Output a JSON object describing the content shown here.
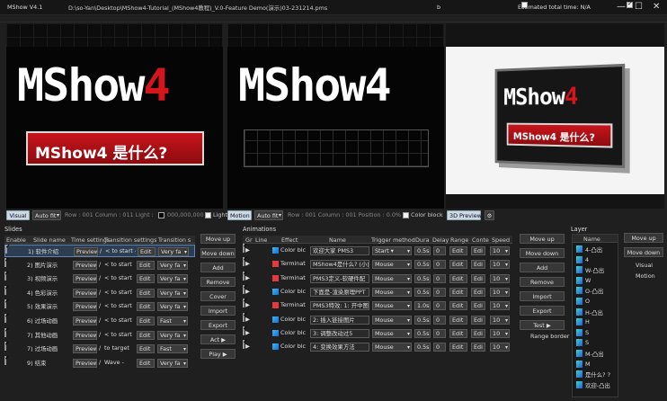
{
  "window": {
    "title": "MShow V4.1",
    "path": "D:\\so-Yan\\Desktop\\MShow4-Tutorial_(MShow4教程)_V.0-Feature Demo(演示)03-231214.pms",
    "letter_b": "b",
    "estimated": "Estimated total time: N/A",
    "min": "—",
    "max": "☐",
    "close": "✕"
  },
  "viewer": {
    "title_a": "MShow",
    "title_b": "4",
    "banner": "MShow4 是什么?"
  },
  "viewer_bar": {
    "visual": "Visual",
    "autofit": "Auto fit",
    "row1": "Row : 001  Column : 011  Light : ",
    "color_val": "000,000,000",
    "light": "Light",
    "motion": "Motion",
    "autofit2": "Auto fit",
    "row2": "Row : 001  Column : 001  Position : 0.0%",
    "colorblock": "Color block",
    "preview3d": "3D Preview",
    "gear": "⚙"
  },
  "slides": {
    "label": "Slides",
    "headers": [
      "Enable",
      "Slide name",
      "Time settings",
      "Transition settings",
      "Transition s"
    ],
    "rows": [
      {
        "name": "1) 软件介绍",
        "preview": "Preview",
        "mid": "/",
        "start": "< to start -",
        "edit": "Edit",
        "speed": "Very fa"
      },
      {
        "name": "2) 图片演示",
        "preview": "Preview",
        "mid": "/",
        "start": "< to start",
        "edit": "Edit",
        "speed": "Very fa"
      },
      {
        "name": "3) 视频演示",
        "preview": "Preview",
        "mid": "/",
        "start": "< to start",
        "edit": "Edit",
        "speed": "Very fa"
      },
      {
        "name": "4) 色彩演示",
        "preview": "Preview",
        "mid": "/",
        "start": "< to start",
        "edit": "Edit",
        "speed": "Very fa"
      },
      {
        "name": "5) 效果演示",
        "preview": "Preview",
        "mid": "/",
        "start": "< to start",
        "edit": "Edit",
        "speed": "Very fa"
      },
      {
        "name": "6) 过场动画",
        "preview": "Preview",
        "mid": "/",
        "start": "< to start",
        "edit": "Edit",
        "speed": "Fast"
      },
      {
        "name": "7) 其他动画",
        "preview": "Preview",
        "mid": "/",
        "start": "< to start",
        "edit": "Edit",
        "speed": "Very fa"
      },
      {
        "name": "7) 过场动画",
        "preview": "Preview",
        "mid": "/",
        "start": "to target",
        "edit": "Edit",
        "speed": "Fast"
      },
      {
        "name": "9) 结束",
        "preview": "Preview",
        "mid": "/",
        "start": "Wave -",
        "edit": "Edit",
        "speed": "Very fa"
      }
    ],
    "buttons": [
      "Move up",
      "Move down",
      "Add",
      "Remove",
      "Cover",
      "Import",
      "Export",
      "Act ▶",
      "Play ▶"
    ]
  },
  "animations": {
    "label": "Animations",
    "headers": [
      "Gr",
      "Line",
      "Effect",
      "Name",
      "Trigger method",
      "Dura",
      "Delay",
      "Range",
      "Conte",
      "Speed"
    ],
    "rows": [
      {
        "effect": "Color blc",
        "icon": "cb",
        "name": "欢迎大家 PMS3",
        "trigger": "Start ▾",
        "dura": "0.5s",
        "delay": "0",
        "range": "Edit",
        "conte": "Edi",
        "speed": "10"
      },
      {
        "effect": "Terminat",
        "icon": "term",
        "name": "MShow4是什么? (小)",
        "trigger": "Mouse",
        "dura": "0.5s",
        "delay": "0",
        "range": "Edit",
        "conte": "Edi",
        "speed": "10"
      },
      {
        "effect": "Terminat",
        "icon": "term",
        "name": "PMS3定义-软硬件配",
        "trigger": "Mouse",
        "dura": "0.5s",
        "delay": "0",
        "range": "Edit",
        "conte": "Edi",
        "speed": "10"
      },
      {
        "effect": "Color blc",
        "icon": "cb",
        "name": "下面是-渲染原理PPT",
        "trigger": "Mouse",
        "dura": "0.5s",
        "delay": "0",
        "range": "Edit",
        "conte": "Edi",
        "speed": "10"
      },
      {
        "effect": "Terminat",
        "icon": "term",
        "name": "PMS3特效: 1: 开中图",
        "trigger": "Mouse",
        "dura": "1.0s",
        "delay": "0",
        "range": "Edit",
        "conte": "Edi",
        "speed": "10"
      },
      {
        "effect": "Color blc",
        "icon": "cb",
        "name": "2: 插入链接图片",
        "trigger": "Mouse",
        "dura": "0.5s",
        "delay": "0",
        "range": "Edit",
        "conte": "Edi",
        "speed": "10"
      },
      {
        "effect": "Color blc",
        "icon": "cb",
        "name": "3: 调整改动过5",
        "trigger": "Mouse",
        "dura": "0.5s",
        "delay": "0",
        "range": "Edit",
        "conte": "Edi",
        "speed": "10"
      },
      {
        "effect": "Color blc",
        "icon": "cb",
        "name": "4: 变换效果方法",
        "trigger": "Mouse",
        "dura": "0.5s",
        "delay": "0",
        "range": "Edit",
        "conte": "Edi",
        "speed": "10"
      }
    ],
    "buttons": [
      "Move up",
      "Move down",
      "Add",
      "Remove",
      "Import",
      "Export",
      "Test ▶"
    ],
    "range_border": "Range border"
  },
  "layer": {
    "label": "Layer",
    "header": "Name",
    "items": [
      "4-凸出",
      "4",
      "W-凸出",
      "W",
      "O-凸出",
      "O",
      "H-凸出",
      "H",
      "S",
      "S",
      "M-凸出",
      "M",
      "是什么? ?",
      "欢迎-凸出"
    ],
    "buttons": [
      "Move up",
      "Move down"
    ],
    "checks": [
      "Visual",
      "Motion"
    ]
  }
}
